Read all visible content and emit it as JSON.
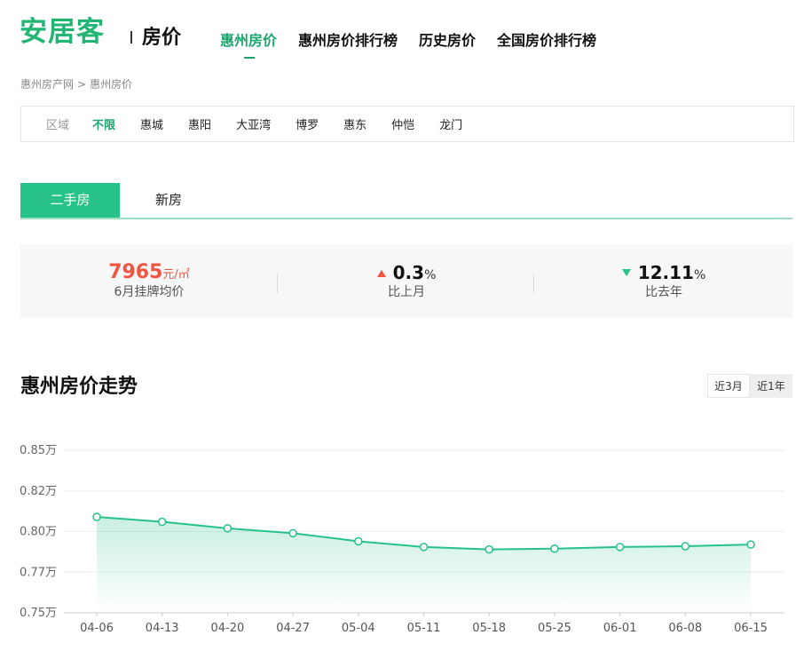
{
  "header": {
    "logo": "安居客",
    "section_title": "房价",
    "nav": [
      "惠州房价",
      "惠州房价排行榜",
      "历史房价",
      "全国房价排行榜"
    ]
  },
  "breadcrumb": [
    "惠州房产网",
    ">",
    "惠州房价"
  ],
  "filter": {
    "label": "区域",
    "items": [
      "不限",
      "惠城",
      "惠阳",
      "大亚湾",
      "博罗",
      "惠东",
      "仲恺",
      "龙门"
    ]
  },
  "tabs": [
    "二手房",
    "新房"
  ],
  "stats": {
    "price": "7965",
    "price_unit": "元/㎡",
    "price_label": "6月挂牌均价",
    "mom_value": "0.3",
    "mom_pct": "%",
    "mom_label": "比上月",
    "yoy_value": "12.11",
    "yoy_pct": "%",
    "yoy_label": "比去年"
  },
  "chart_title": "惠州房价走势",
  "range_buttons": [
    "近3月",
    "近1年"
  ],
  "colors": {
    "accent": "#27c28a",
    "price_red": "#f05540"
  },
  "chart_data": {
    "type": "area",
    "x": [
      "04-06",
      "04-13",
      "04-20",
      "04-27",
      "05-04",
      "05-11",
      "05-18",
      "05-25",
      "06-01",
      "06-08",
      "06-15"
    ],
    "series": [
      {
        "values": [
          0.809,
          0.806,
          0.802,
          0.799,
          0.794,
          0.7905,
          0.789,
          0.7895,
          0.7905,
          0.791,
          0.792
        ]
      }
    ],
    "yticks": [
      "0.85万",
      "0.82万",
      "0.80万",
      "0.77万",
      "0.75万"
    ],
    "ylim": [
      0.75,
      0.85
    ],
    "grid": true
  }
}
